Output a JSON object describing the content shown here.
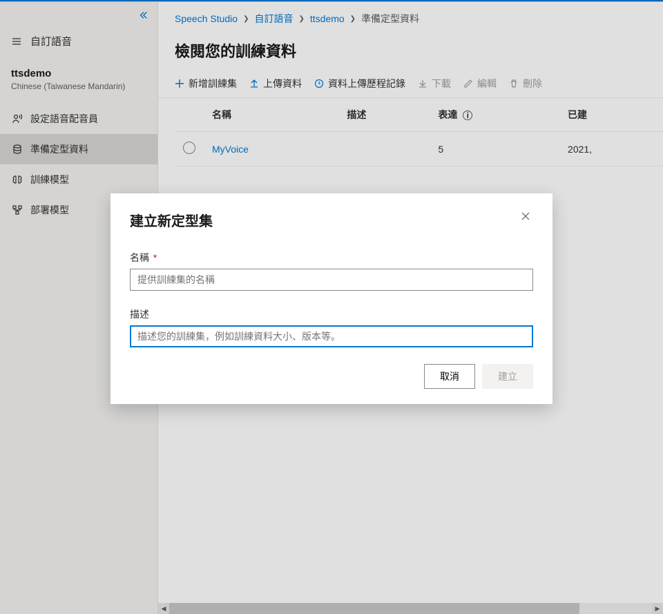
{
  "sidebar": {
    "section_label": "自訂語音",
    "project_name": "ttsdemo",
    "project_lang": "Chinese (Taiwanese Mandarin)",
    "nav": [
      {
        "label": "設定語音配音員"
      },
      {
        "label": "準備定型資料"
      },
      {
        "label": "訓練模型"
      },
      {
        "label": "部署模型"
      }
    ]
  },
  "breadcrumb": {
    "root": "Speech Studio",
    "level1": "自訂語音",
    "level2": "ttsdemo",
    "current": "準備定型資料"
  },
  "page_title": "檢閱您的訓練資料",
  "toolbar": {
    "add": "新增訓練集",
    "upload": "上傳資料",
    "history": "資料上傳歷程記錄",
    "download": "下載",
    "edit": "編輯",
    "delete": "刪除"
  },
  "table": {
    "cols": {
      "name": "名稱",
      "desc": "描述",
      "expr": "表達",
      "created": "已建"
    },
    "rows": [
      {
        "name": "MyVoice",
        "desc": "",
        "expr": "5",
        "created": "2021,"
      }
    ]
  },
  "dialog": {
    "title": "建立新定型集",
    "name_label": "名稱",
    "name_required": "*",
    "name_placeholder": "提供訓練集的名稱",
    "desc_label": "描述",
    "desc_placeholder": "描述您的訓練集，例如訓練資料大小、版本等。",
    "cancel": "取消",
    "create": "建立"
  }
}
